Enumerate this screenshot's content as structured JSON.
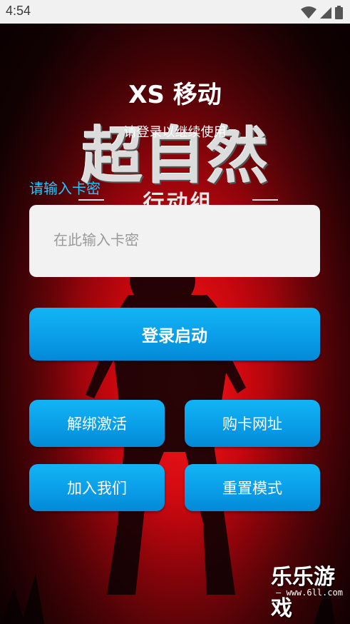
{
  "status_bar": {
    "time": "4:54",
    "icons": [
      "wifi-icon",
      "signal-icon",
      "battery-icon"
    ]
  },
  "app": {
    "title": "XS 移动",
    "subtitle": "请登录以继续使用"
  },
  "logo": {
    "main_text": "超自然",
    "sub_text": "行动组"
  },
  "form": {
    "label": "请输入卡密",
    "input_value": "",
    "input_placeholder": "在此输入卡密"
  },
  "buttons": {
    "login": "登录启动",
    "unbind": "解绑激活",
    "buy": "购卡网址",
    "join": "加入我们",
    "reset": "重置模式"
  },
  "watermark": {
    "brand": "乐乐游戏",
    "url": "— www.6ll.com —"
  },
  "colors": {
    "accent": "#0a9ee8",
    "label": "#22c8ff",
    "background": "#c4060e"
  }
}
